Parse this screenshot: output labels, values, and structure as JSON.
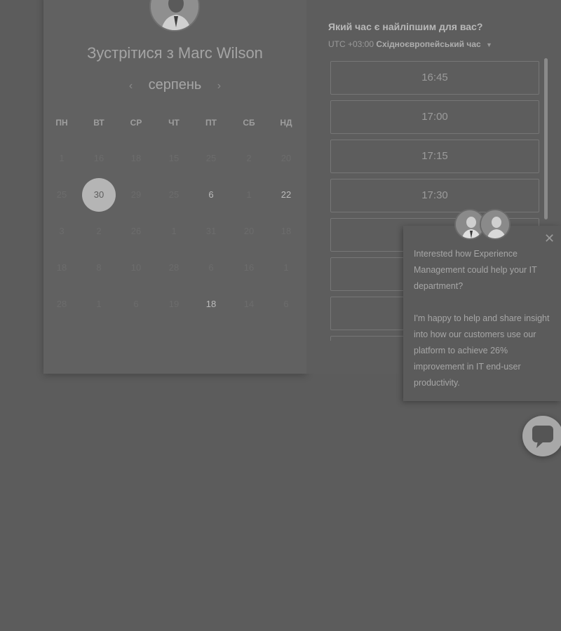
{
  "meeting": {
    "title": "Зустрітися з Marc Wilson"
  },
  "calendar": {
    "month": "серпень",
    "prev_icon": "‹",
    "next_icon": "›",
    "weekdays": [
      "ПН",
      "ВТ",
      "СР",
      "ЧТ",
      "ПТ",
      "СБ",
      "НД"
    ],
    "weeks": [
      [
        "1",
        "16",
        "18",
        "15",
        "25",
        "2",
        "20"
      ],
      [
        "25",
        "30",
        "29",
        "25",
        "6",
        "1",
        "22"
      ],
      [
        "3",
        "2",
        "26",
        "1",
        "31",
        "20",
        "18"
      ],
      [
        "18",
        "8",
        "10",
        "28",
        "6",
        "16",
        "1"
      ],
      [
        "28",
        "1",
        "6",
        "19",
        "18",
        "14",
        "6"
      ]
    ],
    "selected_day": "30"
  },
  "time_panel": {
    "question": "Який час є найліпшим для вас?",
    "timezone_offset": "UTC +03:00",
    "timezone_name": "Східноєвропейський час",
    "caret_icon": "▼",
    "slots": [
      "16:45",
      "17:00",
      "17:15",
      "17:30",
      "",
      "",
      "",
      ""
    ]
  },
  "chat": {
    "close_icon": "✕",
    "message_1": "Interested how Experience Management could help your IT department?",
    "message_2": "I'm happy to help and share insight into how our customers use our platform to achieve 26% improvement in IT end-user productivity."
  },
  "colors": {
    "overlay": "#5c5c5c",
    "selected_day": "#b5b5b5"
  }
}
